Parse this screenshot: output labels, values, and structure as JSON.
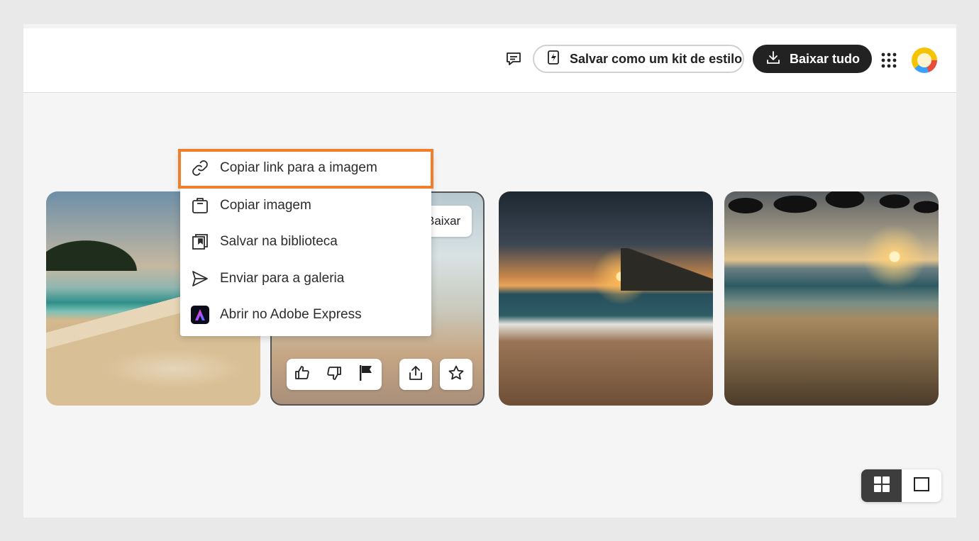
{
  "header": {
    "feedback_icon": "comment-icon",
    "style_kit_label": "Salvar como um kit de estilo",
    "download_all_label": "Baixar tudo",
    "apps_icon": "app-grid-icon",
    "avatar_icon": "avatar"
  },
  "card": {
    "download_label": "Baixar",
    "actions": [
      "thumbs-up-icon",
      "thumbs-down-icon",
      "flag-icon",
      "share-icon",
      "star-icon"
    ]
  },
  "context_menu": {
    "items": [
      {
        "label": "Copiar link para a imagem",
        "icon": "link-icon"
      },
      {
        "label": "Copiar imagem",
        "icon": "copy-icon"
      },
      {
        "label": "Salvar na biblioteca",
        "icon": "library-icon"
      },
      {
        "label": "Enviar para a galeria",
        "icon": "send-icon"
      },
      {
        "label": "Abrir no Adobe Express",
        "icon": "adobe-express-icon"
      }
    ]
  },
  "colors": {
    "highlight": "#ef7f2a",
    "dark_button": "#222222"
  },
  "view_toggle": {
    "grid_icon": "grid-view-icon",
    "single_icon": "single-view-icon"
  }
}
